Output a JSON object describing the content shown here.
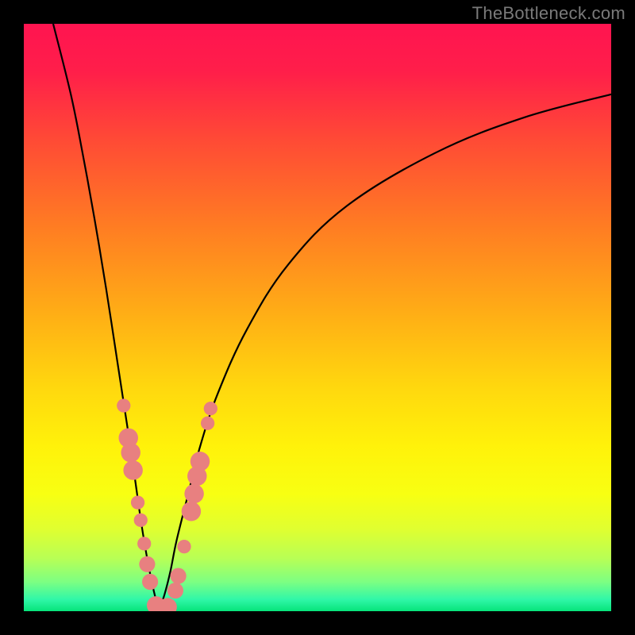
{
  "watermark": "TheBottleneck.com",
  "chart_data": {
    "type": "line",
    "title": "",
    "xlabel": "",
    "ylabel": "",
    "x_range": [
      0,
      100
    ],
    "y_range": [
      0,
      100
    ],
    "note": "V-shaped bottleneck curve with gradient background (red=high bottleneck, green=low bottleneck). Curve minimum (optimal point) near x≈23. Values are estimated from pixel positions since no axis ticks are visible.",
    "series": [
      {
        "name": "bottleneck-curve-left",
        "x": [
          5,
          8,
          10,
          12,
          14,
          16,
          18,
          19,
          20,
          21,
          22,
          23
        ],
        "y": [
          100,
          88,
          78,
          67,
          55,
          42,
          29,
          22,
          15,
          9,
          4,
          0
        ]
      },
      {
        "name": "bottleneck-curve-right",
        "x": [
          23,
          24,
          25,
          26,
          28,
          30,
          33,
          38,
          45,
          55,
          70,
          85,
          100
        ],
        "y": [
          0,
          3,
          7,
          12,
          20,
          28,
          37,
          48,
          59,
          69,
          78,
          84,
          88
        ]
      }
    ],
    "highlight_dots": {
      "name": "sample-points",
      "note": "Salmon-pink circular markers clustered near the curve minimum on both branches.",
      "points": [
        {
          "x": 17.0,
          "y": 35.0,
          "r": 1.2
        },
        {
          "x": 17.8,
          "y": 29.5,
          "r": 1.7
        },
        {
          "x": 18.2,
          "y": 27.0,
          "r": 1.7
        },
        {
          "x": 18.6,
          "y": 24.0,
          "r": 1.7
        },
        {
          "x": 19.4,
          "y": 18.5,
          "r": 1.2
        },
        {
          "x": 19.9,
          "y": 15.5,
          "r": 1.2
        },
        {
          "x": 20.5,
          "y": 11.5,
          "r": 1.2
        },
        {
          "x": 21.0,
          "y": 8.0,
          "r": 1.4
        },
        {
          "x": 21.5,
          "y": 5.0,
          "r": 1.4
        },
        {
          "x": 22.5,
          "y": 1.0,
          "r": 1.6
        },
        {
          "x": 23.5,
          "y": 0.5,
          "r": 1.6
        },
        {
          "x": 24.5,
          "y": 0.7,
          "r": 1.6
        },
        {
          "x": 25.8,
          "y": 3.5,
          "r": 1.4
        },
        {
          "x": 26.3,
          "y": 6.0,
          "r": 1.4
        },
        {
          "x": 27.3,
          "y": 11.0,
          "r": 1.2
        },
        {
          "x": 28.5,
          "y": 17.0,
          "r": 1.7
        },
        {
          "x": 29.0,
          "y": 20.0,
          "r": 1.7
        },
        {
          "x": 29.5,
          "y": 23.0,
          "r": 1.7
        },
        {
          "x": 30.0,
          "y": 25.5,
          "r": 1.7
        },
        {
          "x": 31.3,
          "y": 32.0,
          "r": 1.2
        },
        {
          "x": 31.8,
          "y": 34.5,
          "r": 1.2
        }
      ]
    },
    "gradient_stops": [
      {
        "offset": 0.0,
        "color": "#ff1450"
      },
      {
        "offset": 0.08,
        "color": "#ff1e4a"
      },
      {
        "offset": 0.2,
        "color": "#ff4b35"
      },
      {
        "offset": 0.35,
        "color": "#ff7e22"
      },
      {
        "offset": 0.5,
        "color": "#ffb015"
      },
      {
        "offset": 0.62,
        "color": "#ffd80e"
      },
      {
        "offset": 0.72,
        "color": "#fff20a"
      },
      {
        "offset": 0.8,
        "color": "#f8ff12"
      },
      {
        "offset": 0.86,
        "color": "#e0ff30"
      },
      {
        "offset": 0.91,
        "color": "#b8ff55"
      },
      {
        "offset": 0.95,
        "color": "#7dff82"
      },
      {
        "offset": 0.98,
        "color": "#30f7a8"
      },
      {
        "offset": 1.0,
        "color": "#06e47a"
      }
    ]
  }
}
